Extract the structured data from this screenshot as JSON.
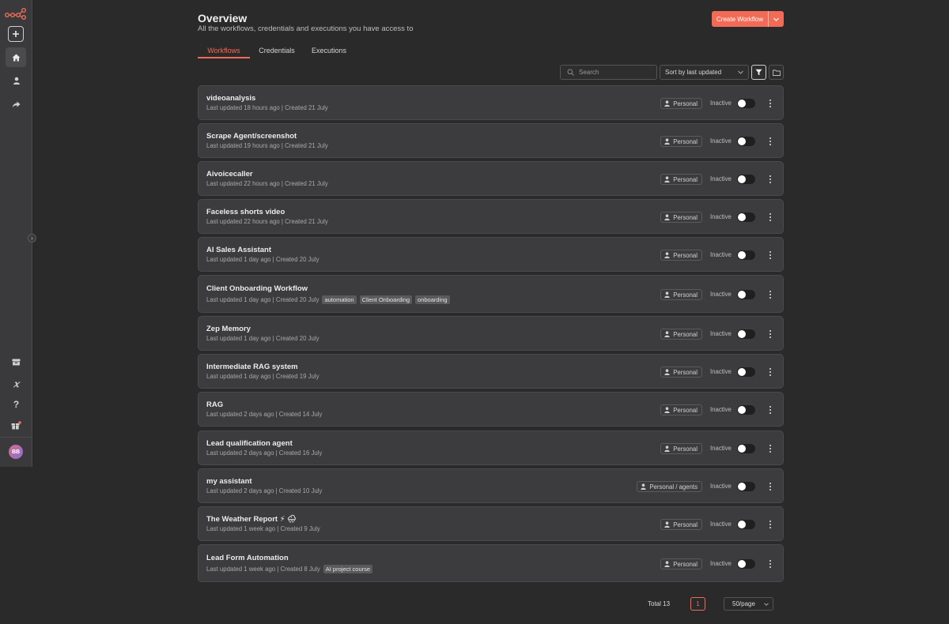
{
  "header": {
    "title": "Overview",
    "subtitle": "All the workflows, credentials and executions you have access to",
    "create_label": "Create Workflow"
  },
  "tabs": [
    {
      "label": "Workflows",
      "active": true
    },
    {
      "label": "Credentials",
      "active": false
    },
    {
      "label": "Executions",
      "active": false
    }
  ],
  "toolbar": {
    "search_placeholder": "Search",
    "sort_label": "Sort by last updated"
  },
  "sidebar": {
    "avatar_initials": "BB",
    "icons": [
      "n8n-logo-icon",
      "add-icon",
      "home-icon",
      "user-icon",
      "share-icon",
      "templates-icon",
      "variables-icon",
      "help-icon",
      "whats-new-icon"
    ]
  },
  "workflows": [
    {
      "name": "videoanalysis",
      "meta": "Last updated 18 hours ago | Created 21 July",
      "tags": [],
      "owner": "Personal",
      "status": "Inactive",
      "active": false
    },
    {
      "name": "Scrape Agent/screenshot",
      "meta": "Last updated 19 hours ago | Created 21 July",
      "tags": [],
      "owner": "Personal",
      "status": "Inactive",
      "active": false
    },
    {
      "name": "Aivoicecaller",
      "meta": "Last updated 22 hours ago | Created 21 July",
      "tags": [],
      "owner": "Personal",
      "status": "Inactive",
      "active": false
    },
    {
      "name": "Faceless shorts video",
      "meta": "Last updated 22 hours ago | Created 21 July",
      "tags": [],
      "owner": "Personal",
      "status": "Inactive",
      "active": false
    },
    {
      "name": "AI Sales Assistant",
      "meta": "Last updated 1 day ago | Created 20 July",
      "tags": [],
      "owner": "Personal",
      "status": "Inactive",
      "active": false
    },
    {
      "name": "Client Onboarding Workflow",
      "meta": "Last updated 1 day ago | Created 20 July",
      "tags": [
        "automation",
        "Client Onboarding",
        "onboarding"
      ],
      "owner": "Personal",
      "status": "Inactive",
      "active": false
    },
    {
      "name": "Zep Memory",
      "meta": "Last updated 1 day ago | Created 20 July",
      "tags": [],
      "owner": "Personal",
      "status": "Inactive",
      "active": false
    },
    {
      "name": "Intermediate RAG system",
      "meta": "Last updated 1 day ago | Created 19 July",
      "tags": [],
      "owner": "Personal",
      "status": "Inactive",
      "active": false
    },
    {
      "name": "RAG",
      "meta": "Last updated 2 days ago | Created 14 July",
      "tags": [],
      "owner": "Personal",
      "status": "Inactive",
      "active": false
    },
    {
      "name": "Lead qualification agent",
      "meta": "Last updated 2 days ago | Created 16 July",
      "tags": [],
      "owner": "Personal",
      "status": "Inactive",
      "active": false
    },
    {
      "name": "my assistant",
      "meta": "Last updated 2 days ago | Created 10 July",
      "tags": [],
      "owner": "Personal / agents",
      "status": "Inactive",
      "active": false
    },
    {
      "name": "The Weather Report ⚡ 🌧",
      "meta": "Last updated 1 week ago | Created 9 July",
      "tags": [],
      "owner": "Personal",
      "status": "Inactive",
      "active": false
    },
    {
      "name": "Lead Form Automation",
      "meta": "Last updated 1 week ago | Created 8 July",
      "tags": [
        "AI project course"
      ],
      "owner": "Personal",
      "status": "Inactive",
      "active": false
    }
  ],
  "pagination": {
    "total_label": "Total 13",
    "current_page": "1",
    "page_size": "50/page"
  },
  "colors": {
    "accent": "#f26b57",
    "background": "#2a2a2a",
    "card": "#3c3c3e"
  }
}
